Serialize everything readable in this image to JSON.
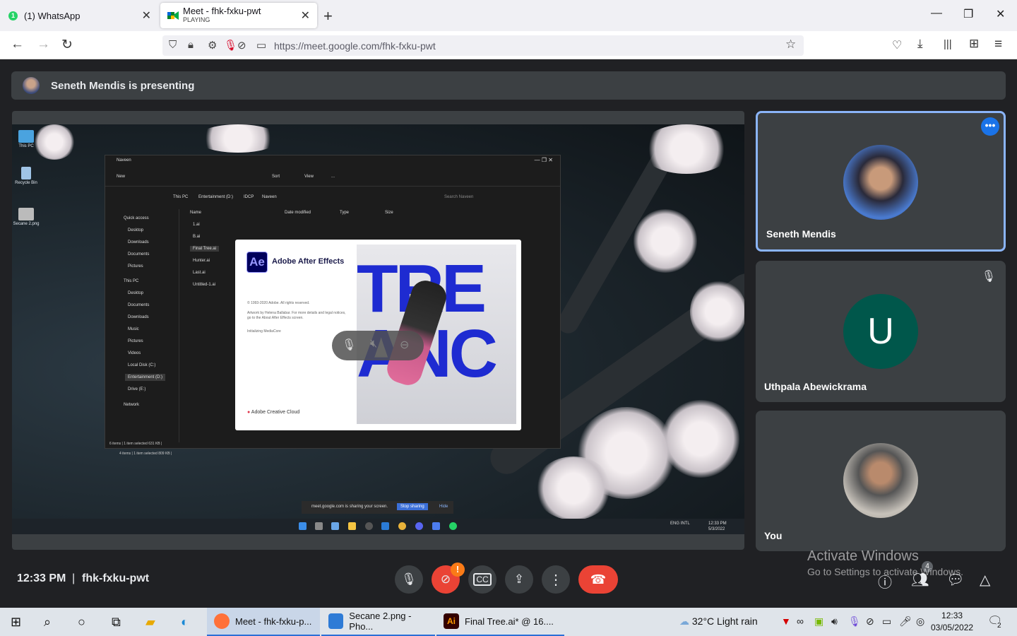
{
  "browser": {
    "tabs": [
      {
        "title": "(1) WhatsApp",
        "badge": "1"
      },
      {
        "title": "Meet - fhk-fxku-pwt",
        "subtitle": "PLAYING"
      }
    ],
    "new_tab": "+",
    "url_prefix": "https://meet.google.com",
    "url_path": "/fhk-fxku-pwt"
  },
  "meet": {
    "presenting_text": "Seneth Mendis is presenting",
    "participants": [
      {
        "name": "Seneth Mendis",
        "speaking": true
      },
      {
        "name": "Uthpala Abewickrama",
        "initial": "U",
        "muted": true,
        "avatar_color": "#00574b"
      },
      {
        "name": "You"
      }
    ],
    "time": "12:33 PM",
    "separator": "|",
    "meeting_code": "fhk-fxku-pwt",
    "participant_count": "4",
    "camera_warning": "!"
  },
  "shared_screen": {
    "desktop_icons": [
      "This PC",
      "Recycle Bin",
      "Secane 2.png"
    ],
    "explorer": {
      "title": "Naveen",
      "toolbar": [
        "New",
        "Sort",
        "View",
        "..."
      ],
      "path": [
        "This PC",
        "Entertainment (D:)",
        "IDCP",
        "Naveen"
      ],
      "search_placeholder": "Search Naveen",
      "columns": [
        "Name",
        "Date modified",
        "Type",
        "Size"
      ],
      "files": [
        "1.ai",
        "B.ai",
        "Final Tree.ai",
        "Hunter.ai",
        "Last.ai",
        "Untitled-1.ai"
      ],
      "sidebar": [
        "Quick access",
        "Desktop",
        "Downloads",
        "Documents",
        "Pictures",
        "This PC",
        "Desktop",
        "Documents",
        "Downloads",
        "Music",
        "Pictures",
        "Videos",
        "Local Disk (C:)",
        "Entertainment (D:)",
        "Drive (E:)",
        "Network"
      ],
      "status": "6 items  |  1 item selected  631 KB  |",
      "status2": "4 items  |  1 item selected  809 KB  |"
    },
    "splash": {
      "logo": "Ae",
      "app_name": "Adobe After Effects",
      "copyright": "© 1993-2020 Adobe. All rights reserved.",
      "artwork": "Artwork by Helena Ballabar. For more details and legal notices, go to the About After Effects screen.",
      "status": "Initializing MediaCore",
      "brand": "Adobe Creative Cloud"
    },
    "share_notice": "meet.google.com is sharing your screen.",
    "stop_sharing": "Stop sharing",
    "hide": "Hide",
    "tray_lang": "ENG INTL",
    "tray_time": "12:33 PM",
    "tray_date": "5/3/2022"
  },
  "activation": {
    "line1": "Activate Windows",
    "line2": "Go to Settings to activate Windows."
  },
  "taskbar": {
    "apps": [
      {
        "label": "Meet - fhk-fxku-p...",
        "color": "#ff7139"
      },
      {
        "label": "Secane 2.png - Pho...",
        "color": "#2e7bd6"
      },
      {
        "label": "Final Tree.ai* @ 16....",
        "color": "#330000"
      }
    ],
    "ai_logo": "Ai",
    "weather": "32°C  Light rain",
    "clock_time": "12:33",
    "clock_date": "03/05/2022",
    "notification_count": "2"
  }
}
